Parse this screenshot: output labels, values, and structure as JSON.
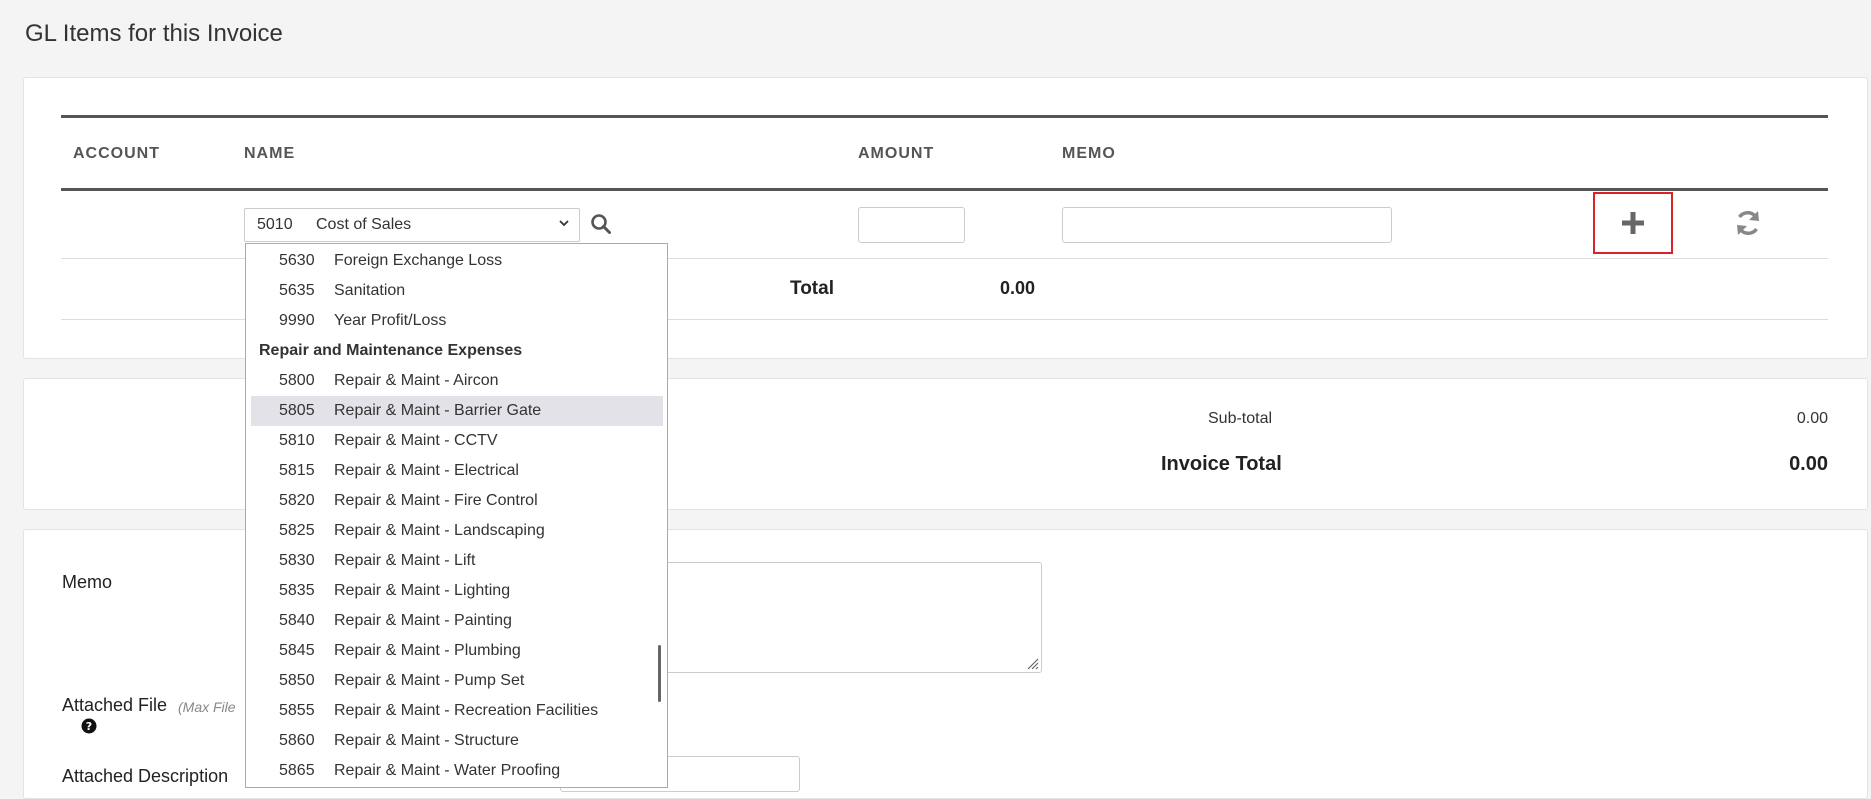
{
  "page": {
    "title": "GL Items for this Invoice"
  },
  "table": {
    "headers": {
      "account": "ACCOUNT",
      "name": "NAME",
      "amount": "AMOUNT",
      "memo": "MEMO"
    },
    "row": {
      "selected_code": "5010",
      "selected_name": "Cost of Sales",
      "amount_value": "",
      "memo_value": ""
    },
    "total_label": "Total",
    "total_value": "0.00"
  },
  "summary": {
    "subtotal_label": "Sub-total",
    "subtotal_value": "0.00",
    "invoice_total_label": "Invoice Total",
    "invoice_total_value": "0.00"
  },
  "form": {
    "memo_label": "Memo",
    "attached_file_label": "Attached File",
    "attached_file_note": "(Max File",
    "attached_description_label": "Attached Description"
  },
  "dropdown": {
    "items_before": [
      {
        "code": "5630",
        "name": "Foreign Exchange Loss"
      },
      {
        "code": "5635",
        "name": "Sanitation"
      },
      {
        "code": "9990",
        "name": "Year Profit/Loss"
      }
    ],
    "group_label": "Repair and Maintenance Expenses",
    "items_after": [
      {
        "code": "5800",
        "name": "Repair & Maint - Aircon"
      },
      {
        "code": "5805",
        "name": "Repair & Maint - Barrier Gate",
        "highlighted": true
      },
      {
        "code": "5810",
        "name": "Repair & Maint - CCTV"
      },
      {
        "code": "5815",
        "name": "Repair & Maint - Electrical"
      },
      {
        "code": "5820",
        "name": "Repair & Maint - Fire Control"
      },
      {
        "code": "5825",
        "name": "Repair & Maint - Landscaping"
      },
      {
        "code": "5830",
        "name": "Repair & Maint - Lift"
      },
      {
        "code": "5835",
        "name": "Repair & Maint - Lighting"
      },
      {
        "code": "5840",
        "name": "Repair & Maint - Painting"
      },
      {
        "code": "5845",
        "name": "Repair & Maint - Plumbing"
      },
      {
        "code": "5850",
        "name": "Repair & Maint - Pump Set"
      },
      {
        "code": "5855",
        "name": "Repair & Maint - Recreation Facilities"
      },
      {
        "code": "5860",
        "name": "Repair & Maint - Structure"
      },
      {
        "code": "5865",
        "name": "Repair & Maint - Water Proofing"
      }
    ]
  },
  "icons": {
    "search": "search-icon",
    "add": "plus-icon",
    "refresh": "refresh-icon",
    "chevron": "chevron-down-icon",
    "help": "question-circle-icon"
  },
  "colors": {
    "highlight_border": "#d9232b",
    "selected_option_bg": "#e2e2e8"
  }
}
